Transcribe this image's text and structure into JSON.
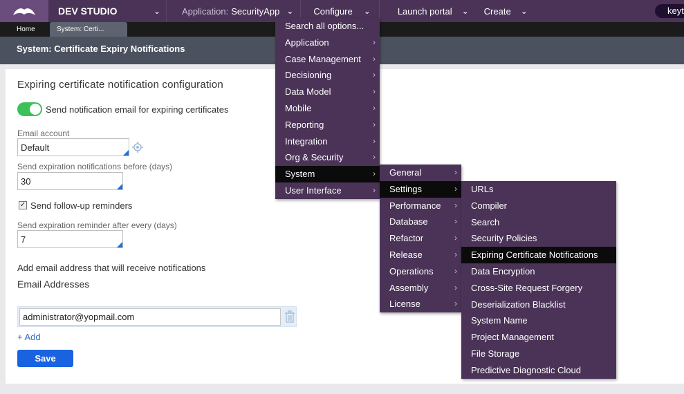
{
  "topbar": {
    "brand": "DEV STUDIO",
    "application_label": "Application:",
    "application_value": "SecurityApp",
    "configure": "Configure",
    "launch_portal": "Launch portal",
    "create": "Create",
    "user": "keyt"
  },
  "tabs": [
    {
      "label": "Home"
    },
    {
      "label": "System: Certi..."
    }
  ],
  "page_title": "System: Certificate Expiry Notifications",
  "form": {
    "heading": "Expiring certificate notification configuration",
    "toggle_label": "Send notification email for expiring certificates",
    "toggle_on": true,
    "email_account_label": "Email account",
    "email_account_value": "Default",
    "notify_before_label": "Send expiration notifications before (days)",
    "notify_before_value": "30",
    "followup_label": "Send follow-up reminders",
    "followup_checked": true,
    "reminder_label": "Send expiration reminder after every (days)",
    "reminder_value": "7",
    "add_email_text": "Add email address that will receive notifications",
    "email_addresses_heading": "Email Addresses",
    "email_values": [
      "administrator@yopmail.com"
    ],
    "add_label": "+ Add",
    "save_label": "Save"
  },
  "configure_menu": [
    {
      "label": "Search all options...",
      "submenu": false
    },
    {
      "label": "Application",
      "submenu": true
    },
    {
      "label": "Case Management",
      "submenu": true
    },
    {
      "label": "Decisioning",
      "submenu": true
    },
    {
      "label": "Data Model",
      "submenu": true
    },
    {
      "label": "Mobile",
      "submenu": true
    },
    {
      "label": "Reporting",
      "submenu": true
    },
    {
      "label": "Integration",
      "submenu": true
    },
    {
      "label": "Org & Security",
      "submenu": true
    },
    {
      "label": "System",
      "submenu": true,
      "highlighted": true
    },
    {
      "label": "User Interface",
      "submenu": true
    }
  ],
  "system_menu": [
    {
      "label": "General",
      "submenu": true
    },
    {
      "label": "Settings",
      "submenu": true,
      "highlighted": true
    },
    {
      "label": "Performance",
      "submenu": true
    },
    {
      "label": "Database",
      "submenu": true
    },
    {
      "label": "Refactor",
      "submenu": true
    },
    {
      "label": "Release",
      "submenu": true
    },
    {
      "label": "Operations",
      "submenu": true
    },
    {
      "label": "Assembly",
      "submenu": true
    },
    {
      "label": "License",
      "submenu": true
    }
  ],
  "settings_menu": [
    {
      "label": "URLs"
    },
    {
      "label": "Compiler"
    },
    {
      "label": "Search"
    },
    {
      "label": "Security Policies"
    },
    {
      "label": "Expiring Certificate Notifications",
      "highlighted": true
    },
    {
      "label": "Data Encryption"
    },
    {
      "label": "Cross-Site Request Forgery"
    },
    {
      "label": "Deserialization Blacklist"
    },
    {
      "label": "System Name"
    },
    {
      "label": "Project Management"
    },
    {
      "label": "File Storage"
    },
    {
      "label": "Predictive Diagnostic Cloud"
    }
  ],
  "colors": {
    "topbar": "#4a3357",
    "menu": "#4a3357",
    "menu_highlight": "#0b0b0b",
    "toggle_on": "#3cc05a",
    "save_button": "#1a63e0"
  }
}
